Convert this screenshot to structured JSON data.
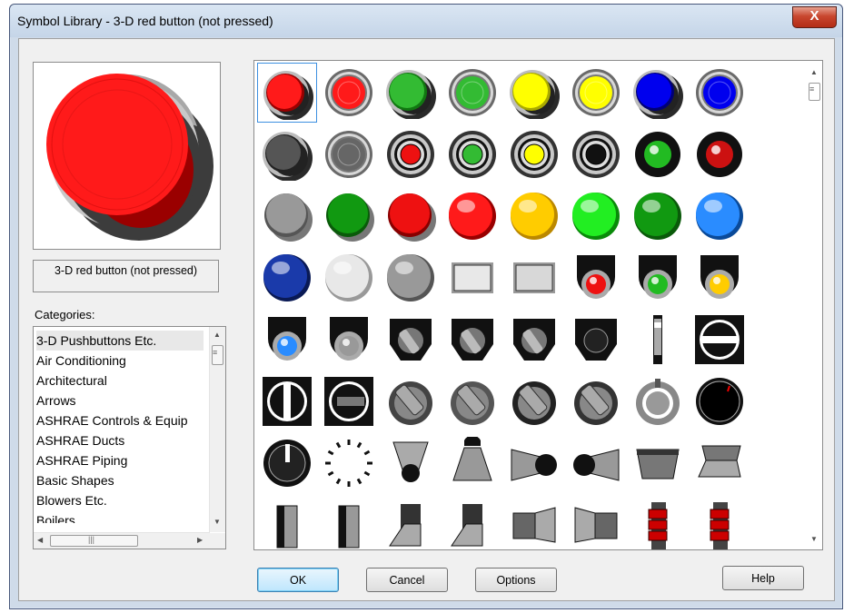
{
  "window": {
    "title": "Symbol Library - 3-D red button (not pressed)",
    "close_label": "X"
  },
  "preview": {
    "symbol_name": "3-D red button (not pressed)",
    "colors": {
      "red": "#ff1a1a",
      "dark_red": "#b00000",
      "gray": "#9a9a9a",
      "shadow": "#3c3c3c"
    }
  },
  "categories": {
    "label": "Categories:",
    "items": [
      "3-D Pushbuttons Etc.",
      "Air Conditioning",
      "Architectural",
      "Arrows",
      "ASHRAE Controls & Equip",
      "ASHRAE Ducts",
      "ASHRAE Piping",
      "Basic Shapes",
      "Blowers Etc.",
      "Boilers"
    ],
    "selected": "3-D Pushbuttons Etc."
  },
  "symbols": {
    "selected_index": 0,
    "rows": [
      [
        "red-3d-button",
        "red-button",
        "green-3d-button",
        "green-button",
        "yellow-3d-button",
        "yellow-button",
        "blue-3d-button",
        "blue-button"
      ],
      [
        "gray-3d-button",
        "gray-button",
        "red-ring-button",
        "green-ring-button",
        "yellow-ring-button",
        "black-ring-button",
        "green-pilot-light",
        "red-pilot-light"
      ],
      [
        "gray-pushbutton",
        "green-pushbutton",
        "red-pushbutton",
        "red-glossy-ball",
        "yellow-glossy-ball",
        "green-glossy-ball",
        "dark-green-glossy-ball",
        "blue-glossy-ball"
      ],
      [
        "dark-blue-glossy-ball",
        "white-glossy-ball",
        "gray-glossy-ball",
        "rectangular-button",
        "small-rectangular-button",
        "red-panel-light",
        "green-panel-light",
        "yellow-panel-light"
      ],
      [
        "blue-panel-light",
        "gray-panel-light",
        "selector-switch-a",
        "selector-switch-b",
        "selector-switch-c",
        "panel-knob",
        "slide-switch",
        "rotary-selector"
      ],
      [
        "vertical-selector",
        "horizontal-selector",
        "gray-lever-knob-a",
        "gray-lever-knob-b",
        "dark-lever-knob-a",
        "dark-lever-knob-b",
        "rotary-knob",
        "black-pointer-knob"
      ],
      [
        "black-dial-knob",
        "dial-scale",
        "funnel-nozzle",
        "conical-nozzle",
        "side-nozzle-right",
        "side-nozzle-left",
        "hopper-tray",
        "tray-chute"
      ],
      [
        "toggle-switch-a",
        "toggle-switch-b",
        "rocker-switch-a",
        "rocker-switch-b",
        "door-open-a",
        "door-open-b",
        "stacked-indicator-a",
        "stacked-indicator-b"
      ]
    ]
  },
  "buttons": {
    "ok": "OK",
    "cancel": "Cancel",
    "options": "Options",
    "help": "Help"
  }
}
